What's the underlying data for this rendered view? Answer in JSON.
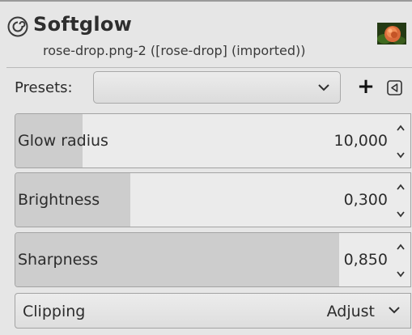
{
  "header": {
    "title": "Softglow",
    "subtitle": "rose-drop.png-2 ([rose-drop] (imported))",
    "icon": "gimp-filter-spiral-icon",
    "thumbnail": "rose-image-thumbnail"
  },
  "presets": {
    "label": "Presets:",
    "selected": "",
    "add_icon": "+",
    "menu_icon": "triangle-left-menu-icon"
  },
  "params": [
    {
      "label": "Glow radius",
      "value": "10,000",
      "level": 0.17
    },
    {
      "label": "Brightness",
      "value": "0,300",
      "level": 0.29
    },
    {
      "label": "Sharpness",
      "value": "0,850",
      "level": 0.82
    }
  ],
  "clipping": {
    "label": "Clipping",
    "value": "Adjust"
  },
  "colors": {
    "background": "#e6e6e6",
    "scale_fill": "#cdcdcd",
    "scale_bg": "#ebebeb"
  }
}
